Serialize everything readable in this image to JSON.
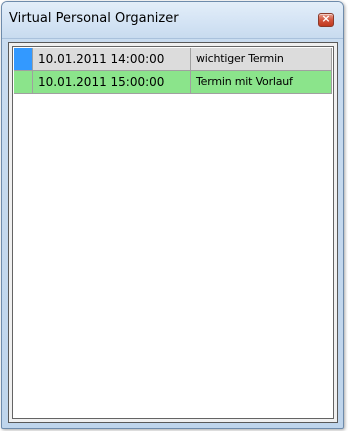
{
  "window": {
    "title": "Virtual Personal Organizer",
    "close_glyph": "×",
    "close_icon": "close-icon"
  },
  "appointments": [
    {
      "datetime": "10.01.2011 14:00:00",
      "subject": "wichtiger Termin",
      "marker_color": "#3399ff",
      "row_color": "#dcdcdc"
    },
    {
      "datetime": "10.01.2011 15:00:00",
      "subject": "Termin mit Vorlauf",
      "marker_color": "#8be48b",
      "row_color": "#8be48b"
    }
  ]
}
